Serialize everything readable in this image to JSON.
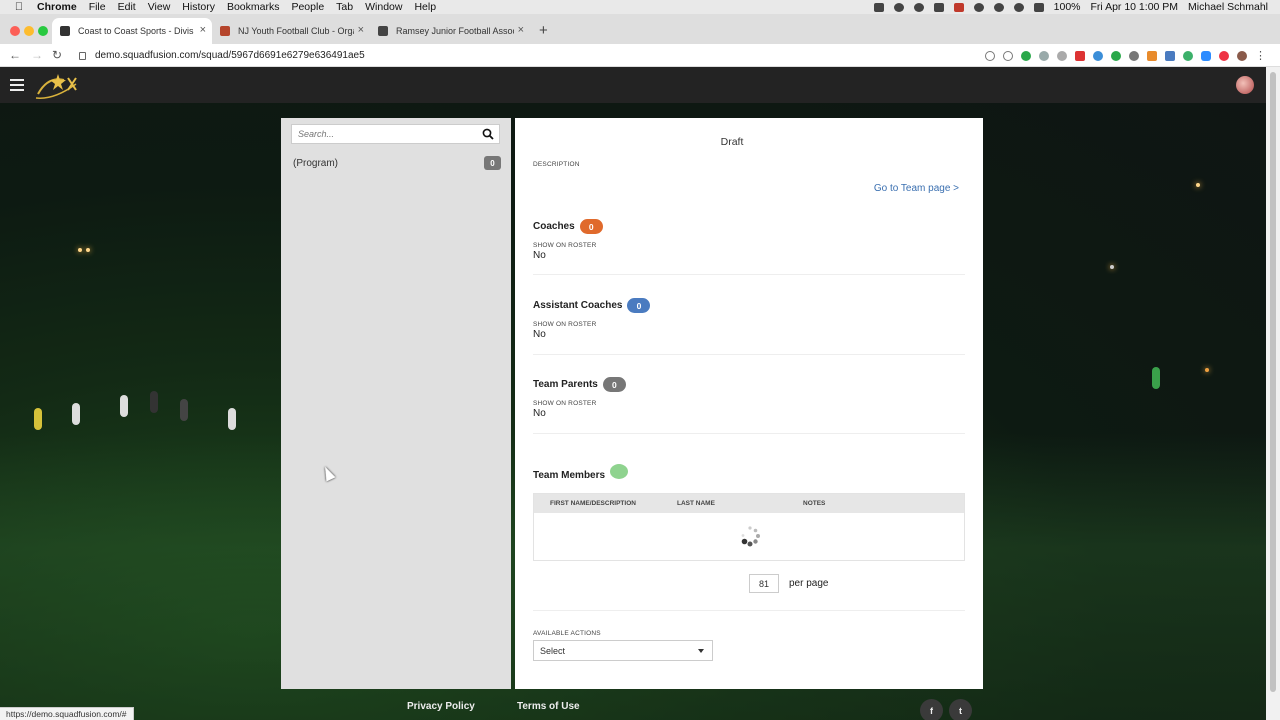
{
  "mac_menu": {
    "app": "Chrome",
    "items": [
      "File",
      "Edit",
      "View",
      "History",
      "Bookmarks",
      "People",
      "Tab",
      "Window",
      "Help"
    ],
    "battery": "100%",
    "datetime": "Fri Apr 10  1:00 PM",
    "user": "Michael Schmahl"
  },
  "browser": {
    "tabs": [
      {
        "title": "Coast to Coast Sports - Divisio",
        "active": true
      },
      {
        "title": "NJ Youth Football Club - Orga",
        "active": false
      },
      {
        "title": "Ramsey Junior Football Associ",
        "active": false
      }
    ],
    "url": "demo.squadfusion.com/squad/5967d6691e6279e636491ae5",
    "status_url": "https://demo.squadfusion.com/#"
  },
  "sidebar": {
    "search_placeholder": "Search...",
    "items": [
      {
        "label": "(Program)",
        "count": "0"
      }
    ]
  },
  "detail": {
    "title": "Draft",
    "description_label": "DESCRIPTION",
    "team_link": "Go to Team page >",
    "coaches": {
      "title": "Coaches",
      "count": "0",
      "roster_label": "SHOW ON ROSTER",
      "roster_value": "No"
    },
    "assistant_coaches": {
      "title": "Assistant Coaches",
      "count": "0",
      "roster_label": "SHOW ON ROSTER",
      "roster_value": "No"
    },
    "team_parents": {
      "title": "Team Parents",
      "count": "0",
      "roster_label": "SHOW ON ROSTER",
      "roster_value": "No"
    },
    "team_members": {
      "title": "Team Members",
      "columns": [
        "FIRST NAME/DESCRIPTION",
        "LAST NAME",
        "NOTES"
      ]
    },
    "per_page_value": "81",
    "per_page_label": "per page",
    "actions_label": "AVAILABLE ACTIONS",
    "actions_select": "Select"
  },
  "footer": {
    "privacy": "Privacy Policy",
    "terms": "Terms of Use",
    "facebook": "f",
    "twitter": "t"
  },
  "colors": {
    "coaches_badge": "#e06a2c",
    "assistant_badge": "#4a7bc0",
    "parents_badge": "#777777",
    "link": "#3a6fb0"
  }
}
